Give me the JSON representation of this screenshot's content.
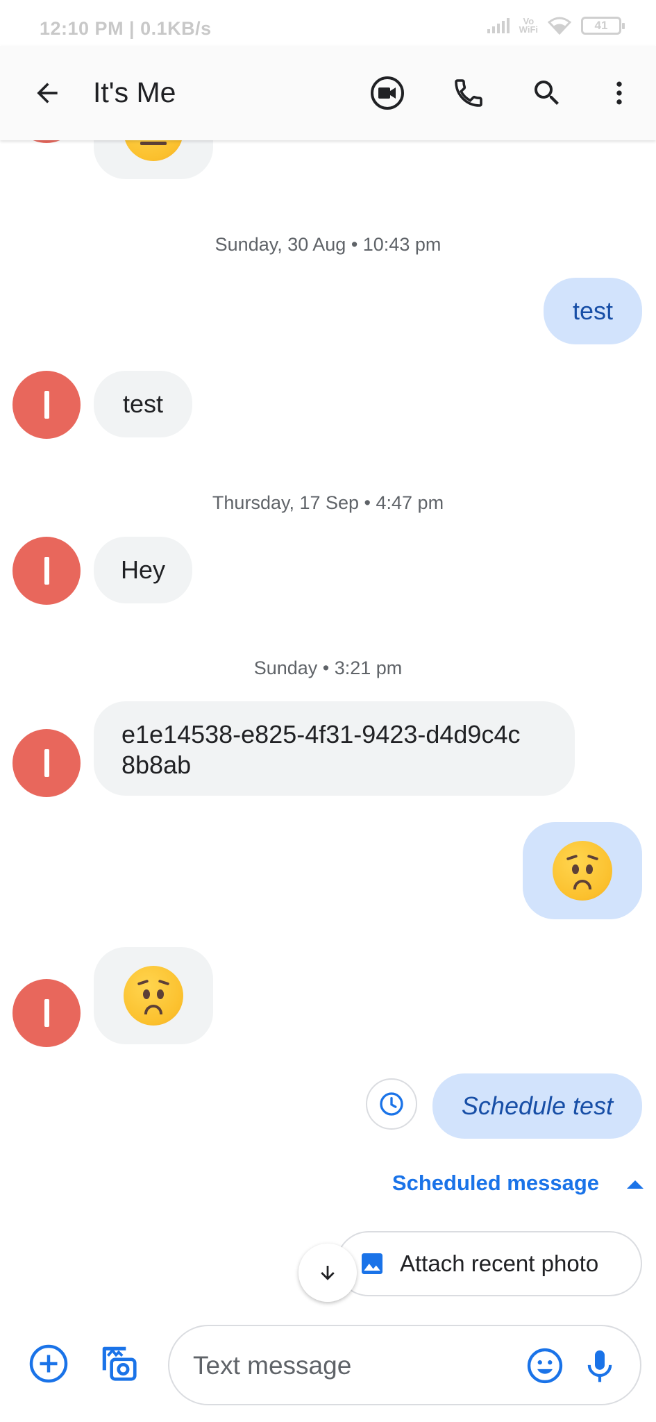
{
  "status_bar": {
    "time": "12:10 PM | 0.1KB/s",
    "vowifi_top": "Vo",
    "vowifi_bottom": "WiFi",
    "battery": "41"
  },
  "app_bar": {
    "title": "It's Me",
    "icons": [
      "back-arrow-icon",
      "video-call-icon",
      "phone-icon",
      "search-icon",
      "more-vert-icon"
    ]
  },
  "thread": {
    "contact_initial": "I",
    "separators": [
      "Sunday, 30 Aug • 10:43 pm",
      "Thursday, 17 Sep • 4:47 pm",
      "Sunday • 3:21 pm"
    ],
    "messages": [
      {
        "direction": "incoming",
        "type": "emoji",
        "emoji": "neutral-face"
      },
      {
        "direction": "outgoing",
        "text": "test"
      },
      {
        "direction": "incoming",
        "text": "test"
      },
      {
        "direction": "incoming",
        "text": "Hey"
      },
      {
        "direction": "incoming",
        "text_line1": "e1e14538-e825-4f31-9423-d4d9c4c",
        "text_line2": "8b8ab"
      },
      {
        "direction": "outgoing",
        "type": "emoji",
        "emoji": "worried-face"
      },
      {
        "direction": "incoming",
        "type": "emoji",
        "emoji": "worried-face"
      },
      {
        "direction": "outgoing",
        "text": "Schedule test",
        "scheduled": true
      }
    ],
    "scheduled_label": "Scheduled message",
    "attach_recent_photo": "Attach recent photo"
  },
  "composer": {
    "placeholder": "Text message"
  },
  "colors": {
    "accent": "#1a73e8",
    "avatar": "#e8675c",
    "incoming_bubble": "#f1f3f4",
    "outgoing_bubble": "#d2e3fc"
  }
}
